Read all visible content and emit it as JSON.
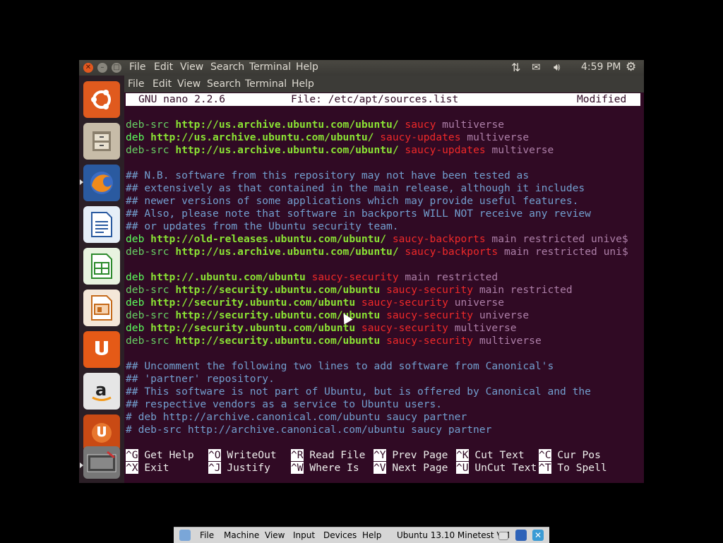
{
  "top_panel": {
    "menus": [
      "File",
      "Edit",
      "View",
      "Search",
      "Terminal",
      "Help"
    ],
    "clock": "4:59 PM",
    "icons": [
      "network-icon",
      "mail-icon",
      "volume-icon",
      "gear-icon"
    ]
  },
  "terminal_menu": [
    "File",
    "Edit",
    "View",
    "Search",
    "Terminal",
    "Help"
  ],
  "nano": {
    "version": "GNU nano 2.2.6",
    "file": "File: /etc/apt/sources.list",
    "status": "Modified"
  },
  "lines": [
    {
      "row": 2,
      "parts": [
        [
          "kwd",
          "deb-src"
        ],
        [
          "t",
          " "
        ],
        [
          "url",
          "http://us.archive.ubuntu.com/ubuntu/"
        ],
        [
          "t",
          " "
        ],
        [
          "suite",
          "saucy"
        ],
        [
          "t",
          " "
        ],
        [
          "comp",
          "multiverse"
        ]
      ]
    },
    {
      "row": 3,
      "parts": [
        [
          "kw",
          "deb"
        ],
        [
          "t",
          " "
        ],
        [
          "url",
          "http://us.archive.ubuntu.com/ubuntu/"
        ],
        [
          "t",
          " "
        ],
        [
          "suite",
          "saucy-updates"
        ],
        [
          "t",
          " "
        ],
        [
          "comp",
          "multiverse"
        ]
      ]
    },
    {
      "row": 4,
      "parts": [
        [
          "kwd",
          "deb-src"
        ],
        [
          "t",
          " "
        ],
        [
          "url",
          "http://us.archive.ubuntu.com/ubuntu/"
        ],
        [
          "t",
          " "
        ],
        [
          "suite",
          "saucy-updates"
        ],
        [
          "t",
          " "
        ],
        [
          "comp",
          "multiverse"
        ]
      ]
    },
    {
      "row": 6,
      "parts": [
        [
          "comment",
          "## N.B. software from this repository may not have been tested as"
        ]
      ]
    },
    {
      "row": 7,
      "parts": [
        [
          "comment",
          "## extensively as that contained in the main release, although it includes"
        ]
      ]
    },
    {
      "row": 8,
      "parts": [
        [
          "comment",
          "## newer versions of some applications which may provide useful features."
        ]
      ]
    },
    {
      "row": 9,
      "parts": [
        [
          "comment",
          "## Also, please note that software in backports WILL NOT receive any review"
        ]
      ]
    },
    {
      "row": 10,
      "parts": [
        [
          "comment",
          "## or updates from the Ubuntu security team."
        ]
      ]
    },
    {
      "row": 11,
      "parts": [
        [
          "kw",
          "deb"
        ],
        [
          "t",
          " "
        ],
        [
          "url",
          "http://old-releases.ubuntu.com/ubuntu/"
        ],
        [
          "t",
          " "
        ],
        [
          "suite",
          "saucy-backports"
        ],
        [
          "t",
          " "
        ],
        [
          "comp",
          "main restricted unive$"
        ]
      ]
    },
    {
      "row": 12,
      "parts": [
        [
          "kwd",
          "deb-src"
        ],
        [
          "t",
          " "
        ],
        [
          "url",
          "http://us.archive.ubuntu.com/ubuntu/"
        ],
        [
          "t",
          " "
        ],
        [
          "suite",
          "saucy-backports"
        ],
        [
          "t",
          " "
        ],
        [
          "comp",
          "main restricted uni$"
        ]
      ]
    },
    {
      "row": 14,
      "parts": [
        [
          "kw",
          "deb"
        ],
        [
          "t",
          " "
        ],
        [
          "url",
          "http://.ubuntu.com/ubuntu"
        ],
        [
          "t",
          " "
        ],
        [
          "suite",
          "saucy-security"
        ],
        [
          "t",
          " "
        ],
        [
          "comp",
          "main restricted"
        ]
      ]
    },
    {
      "row": 15,
      "parts": [
        [
          "kwd",
          "deb-src"
        ],
        [
          "t",
          " "
        ],
        [
          "url",
          "http://security.ubuntu.com/ubuntu"
        ],
        [
          "t",
          " "
        ],
        [
          "suite",
          "saucy-security"
        ],
        [
          "t",
          " "
        ],
        [
          "comp",
          "main restricted"
        ]
      ]
    },
    {
      "row": 16,
      "parts": [
        [
          "kw",
          "deb"
        ],
        [
          "t",
          " "
        ],
        [
          "url",
          "http://security.ubuntu.com/ubuntu"
        ],
        [
          "t",
          " "
        ],
        [
          "suite",
          "saucy-security"
        ],
        [
          "t",
          " "
        ],
        [
          "comp",
          "universe"
        ]
      ]
    },
    {
      "row": 17,
      "parts": [
        [
          "kwd",
          "deb-src"
        ],
        [
          "t",
          " "
        ],
        [
          "url",
          "http://security.ubuntu.com/ubuntu"
        ],
        [
          "t",
          " "
        ],
        [
          "suite",
          "saucy-security"
        ],
        [
          "t",
          " "
        ],
        [
          "comp",
          "universe"
        ]
      ]
    },
    {
      "row": 18,
      "parts": [
        [
          "kw",
          "deb"
        ],
        [
          "t",
          " "
        ],
        [
          "url",
          "http://security.ubuntu.com/ubuntu"
        ],
        [
          "t",
          " "
        ],
        [
          "suite",
          "saucy-security"
        ],
        [
          "t",
          " "
        ],
        [
          "comp",
          "multiverse"
        ]
      ]
    },
    {
      "row": 19,
      "parts": [
        [
          "kwd",
          "deb-src"
        ],
        [
          "t",
          " "
        ],
        [
          "url",
          "http://security.ubuntu.com/ubuntu"
        ],
        [
          "t",
          " "
        ],
        [
          "suite",
          "saucy-security"
        ],
        [
          "t",
          " "
        ],
        [
          "comp",
          "multiverse"
        ]
      ]
    },
    {
      "row": 21,
      "parts": [
        [
          "comment",
          "## Uncomment the following two lines to add software from Canonical's"
        ]
      ]
    },
    {
      "row": 22,
      "parts": [
        [
          "comment",
          "## 'partner' repository."
        ]
      ]
    },
    {
      "row": 23,
      "parts": [
        [
          "comment",
          "## This software is not part of Ubuntu, but is offered by Canonical and the"
        ]
      ]
    },
    {
      "row": 24,
      "parts": [
        [
          "comment",
          "## respective vendors as a service to Ubuntu users."
        ]
      ]
    },
    {
      "row": 25,
      "parts": [
        [
          "comment",
          "# deb http://archive.canonical.com/ubuntu saucy partner"
        ]
      ]
    },
    {
      "row": 26,
      "parts": [
        [
          "comment",
          "# deb-src http://archive.canonical.com/ubuntu saucy partner"
        ]
      ]
    }
  ],
  "shortcuts": [
    [
      {
        "key": "^G",
        "label": "Get Help"
      },
      {
        "key": "^O",
        "label": "WriteOut"
      },
      {
        "key": "^R",
        "label": "Read File"
      },
      {
        "key": "^Y",
        "label": "Prev Page"
      },
      {
        "key": "^K",
        "label": "Cut Text"
      },
      {
        "key": "^C",
        "label": "Cur Pos"
      }
    ],
    [
      {
        "key": "^X",
        "label": "Exit"
      },
      {
        "key": "^J",
        "label": "Justify"
      },
      {
        "key": "^W",
        "label": "Where Is"
      },
      {
        "key": "^V",
        "label": "Next Page"
      },
      {
        "key": "^U",
        "label": "UnCut Text"
      },
      {
        "key": "^T",
        "label": "To Spell"
      }
    ]
  ],
  "launcher": [
    "ubuntu-dash-icon",
    "files-icon",
    "firefox-icon",
    "writer-icon",
    "calc-icon",
    "impress-icon",
    "ubuntu-one-icon",
    "amazon-icon",
    "ubuntu-one-music-icon",
    "workspace-switcher-icon"
  ],
  "vbox": {
    "menus": [
      "File",
      "Machine",
      "View",
      "Input",
      "Devices",
      "Help"
    ],
    "title": "Ubuntu 13.10 Minetest VM"
  }
}
